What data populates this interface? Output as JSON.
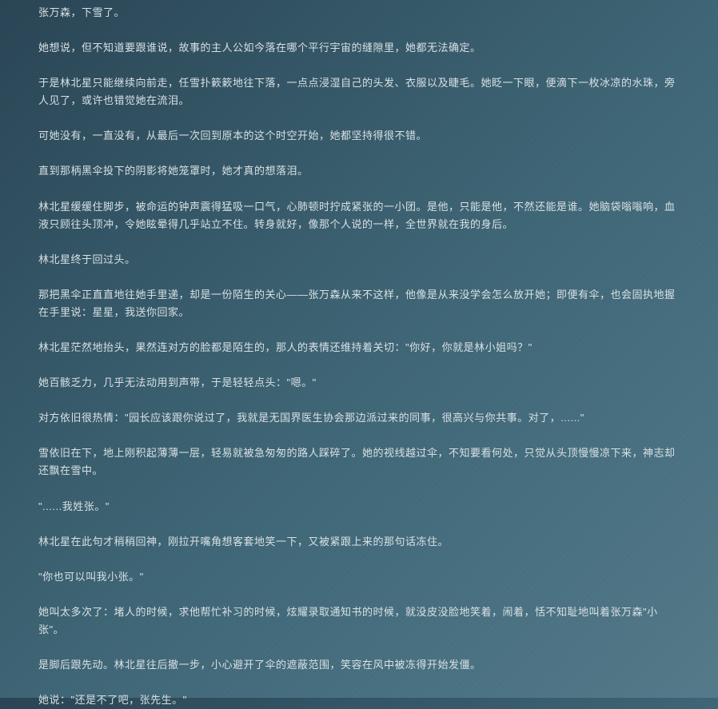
{
  "paragraphs": [
    "张万森，下雪了。",
    "她想说，但不知道要跟谁说，故事的主人公如今落在哪个平行宇宙的缝隙里，她都无法确定。",
    "于是林北星只能继续向前走，任雪扑簌簌地往下落，一点点浸湿自己的头发、衣服以及睫毛。她眨一下眼，便滴下一枚冰凉的水珠，旁人见了，或许也错觉她在流泪。",
    "可她没有，一直没有，从最后一次回到原本的这个时空开始，她都坚持得很不错。",
    "直到那柄黑伞投下的阴影将她笼罩时，她才真的想落泪。",
    "林北星缓缓住脚步，被命运的钟声震得猛吸一口气，心肺顿时拧成紧张的一小团。是他，只能是他，不然还能是谁。她脑袋嗡嗡响，血液只顾往头顶冲，令她眩晕得几乎站立不住。转身就好，像那个人说的一样，全世界就在我的身后。",
    "林北星终于回过头。",
    "那把黑伞正直直地往她手里递，却是一份陌生的关心——张万森从来不这样，他像是从来没学会怎么放开她；即便有伞，也会固执地握在手里说：星星，我送你回家。",
    "林北星茫然地抬头，果然连对方的脸都是陌生的，那人的表情还维持着关切：\"你好，你就是林小姐吗？\"",
    "她百骸乏力，几乎无法动用到声带，于是轻轻点头：\"嗯。\"",
    "对方依旧很热情：\"园长应该跟你说过了，我就是无国界医生协会那边派过来的同事，很高兴与你共事。对了，......\"",
    "雪依旧在下，地上刚积起薄薄一层，轻易就被急匆匆的路人踩碎了。她的视线越过伞，不知要看何处，只觉从头顶慢慢凉下来，神志却还飘在雪中。",
    "\"......我姓张。\"",
    "林北星在此句才稍稍回神，刚拉开嘴角想客套地笑一下，又被紧跟上来的那句话冻住。",
    "\"你也可以叫我小张。\"",
    "她叫太多次了：堵人的时候，求他帮忙补习的时候，炫耀录取通知书的时候，就没皮没脸地笑着，闹着，恬不知耻地叫着张万森\"小张\"。",
    "是脚后跟先动。林北星往后撤一步，小心避开了伞的遮蔽范围，笑容在风中被冻得开始发僵。",
    "她说：\"还是不了吧，张先生。\""
  ]
}
